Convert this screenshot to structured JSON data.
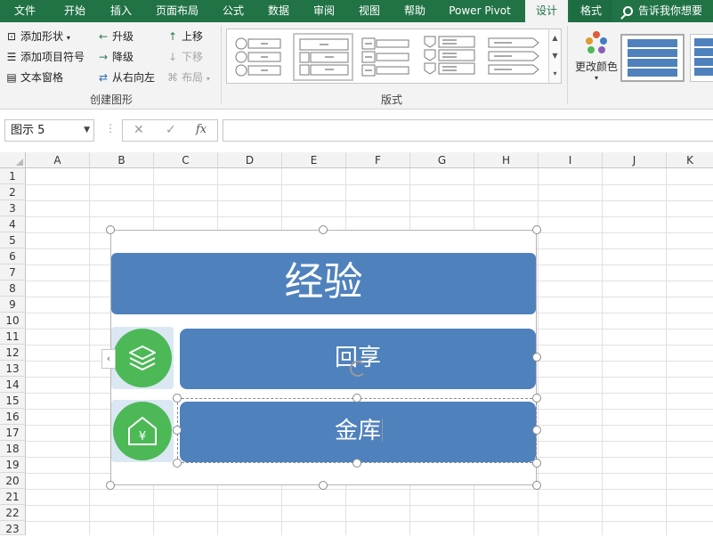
{
  "tabs": [
    {
      "label": "文件"
    },
    {
      "label": "开始"
    },
    {
      "label": "插入"
    },
    {
      "label": "页面布局"
    },
    {
      "label": "公式"
    },
    {
      "label": "数据"
    },
    {
      "label": "审阅"
    },
    {
      "label": "视图"
    },
    {
      "label": "帮助"
    },
    {
      "label": "Power Pivot"
    },
    {
      "label": "设计",
      "active": true
    },
    {
      "label": "格式"
    }
  ],
  "tellme": "告诉我你想要",
  "ribbon": {
    "create_group": {
      "add_shape": "添加形状",
      "add_bullet": "添加项目符号",
      "text_pane": "文本窗格",
      "promote": "升级",
      "demote": "降级",
      "right_to_left": "从右向左",
      "move_up": "上移",
      "move_down": "下移",
      "layout": "布局",
      "label": "创建图形"
    },
    "layouts_group": {
      "label": "版式"
    },
    "change_colors": "更改颜色"
  },
  "formula_bar": {
    "name_box": "图示 5",
    "cancel_icon": "✕",
    "enter_icon": "✓",
    "fx": "fx",
    "value": ""
  },
  "columns": [
    "A",
    "B",
    "C",
    "D",
    "E",
    "F",
    "G",
    "H",
    "I",
    "J",
    "K"
  ],
  "rows": [
    "1",
    "2",
    "3",
    "4",
    "5",
    "6",
    "7",
    "8",
    "9",
    "10",
    "11",
    "12",
    "13",
    "14",
    "15",
    "16",
    "17",
    "18",
    "19",
    "20",
    "21",
    "22",
    "23"
  ],
  "smartart": {
    "title": "经验",
    "items": [
      {
        "text": "回享",
        "icon": "layers-icon"
      },
      {
        "text": "金库",
        "icon": "yuan-house-icon"
      }
    ],
    "colors": {
      "box": "#4f81bd",
      "circle": "#4cb956",
      "tile": "#dbe8f4"
    }
  }
}
